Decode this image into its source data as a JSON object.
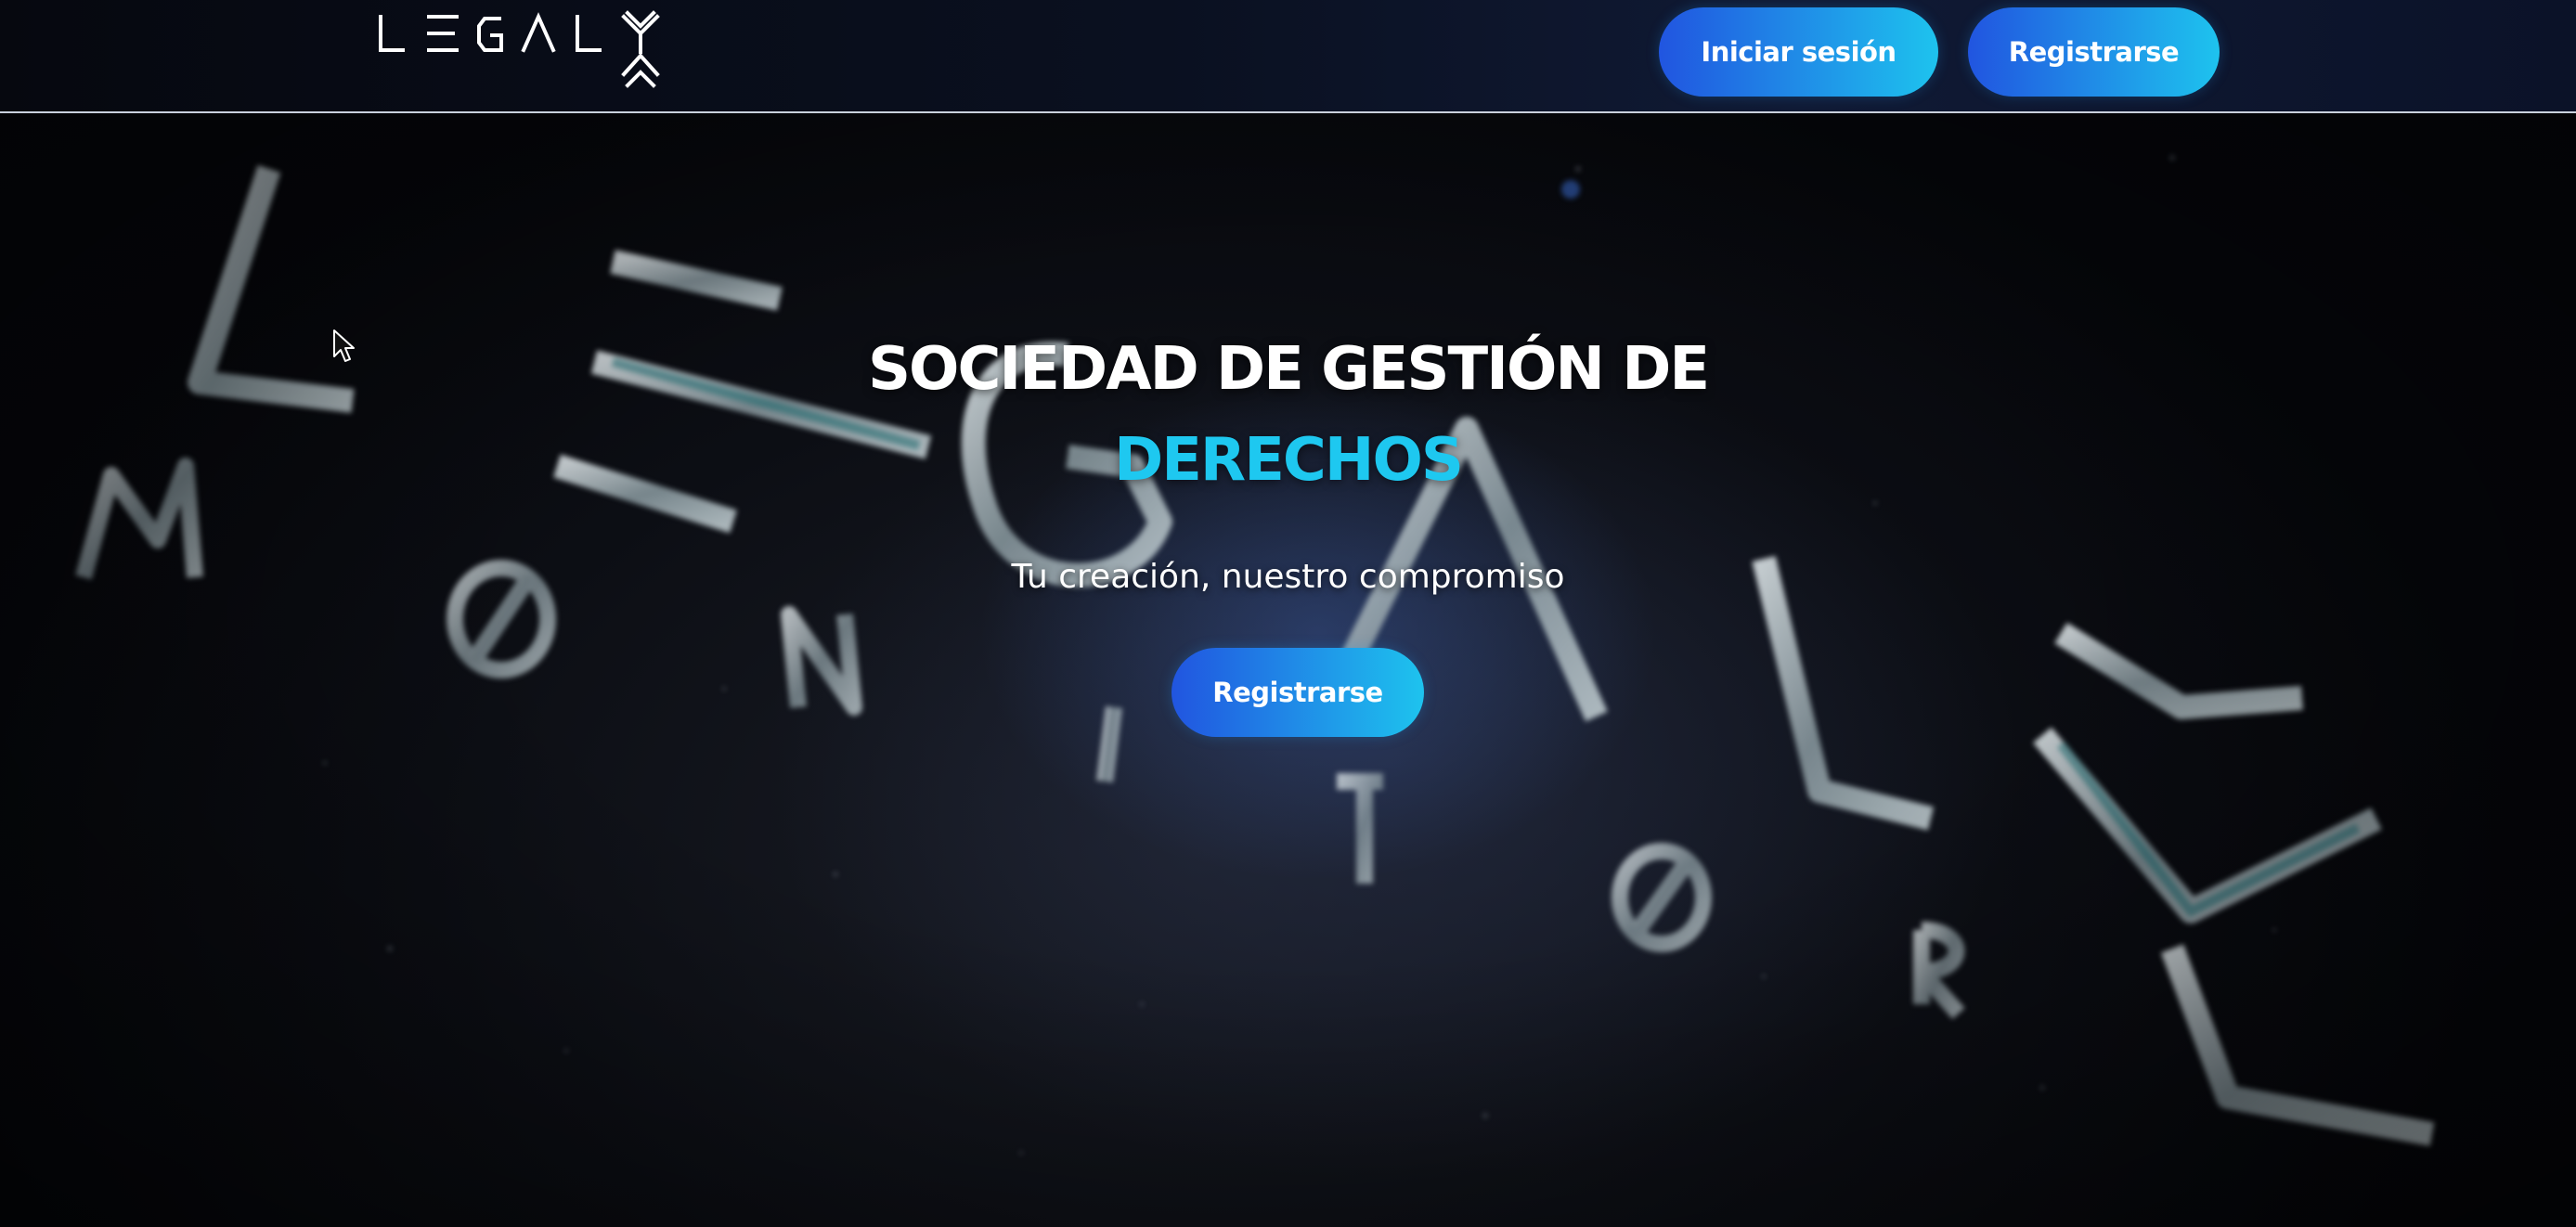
{
  "header": {
    "logo": {
      "name": "LEGAL MONITOR",
      "top_text": "LEGAL",
      "bottom_text": "MØNITØR"
    },
    "login_label": "Iniciar sesión",
    "register_label": "Registrarse"
  },
  "hero": {
    "title": "SOCIEDAD DE GESTIÓN DE",
    "accent": "DERECHOS",
    "subtitle": "Tu creación, nuestro compromiso",
    "cta_label": "Registrarse",
    "background": "blurred 3D metallic LEGAL MONITOR logo letters on dark starry surface"
  },
  "colors": {
    "accent": "#1ec8f0",
    "button_gradient_start": "#2155e0",
    "button_gradient_end": "#1ec3ee",
    "header_bg": "#0a1020",
    "text": "#ffffff"
  },
  "icons": [
    "logo-mark",
    "mouse-cursor-icon"
  ]
}
